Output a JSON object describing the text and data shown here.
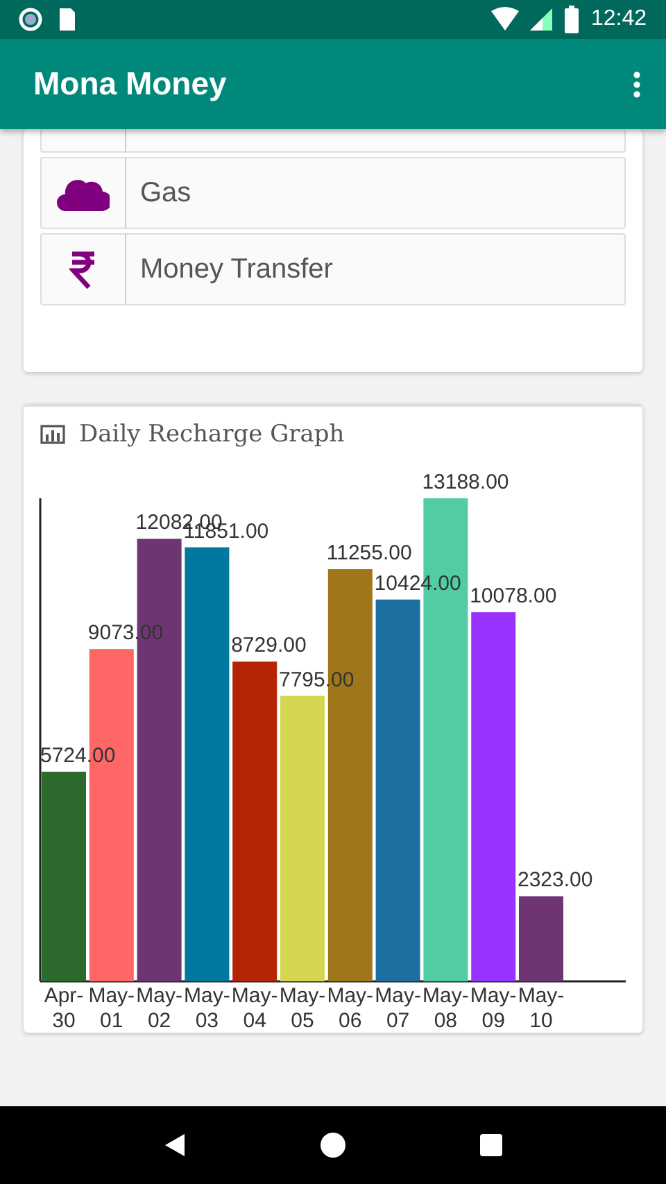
{
  "status_bar": {
    "time": "12:42"
  },
  "app_bar": {
    "title": "Mona Money"
  },
  "services": [
    {
      "kind": "partial"
    },
    {
      "kind": "cloud",
      "label": "Gas"
    },
    {
      "kind": "rupee",
      "label": "Money Transfer"
    }
  ],
  "graph_card": {
    "title": "Daily Recharge Graph",
    "chart_data": {
      "type": "bar",
      "categories": [
        "Apr-30",
        "May-01",
        "May-02",
        "May-03",
        "May-04",
        "May-05",
        "May-06",
        "May-07",
        "May-08",
        "May-09",
        "May-10"
      ],
      "values": [
        5724,
        9073,
        12082,
        11851,
        8729,
        7795,
        11255,
        10424,
        13188,
        10078,
        2323
      ],
      "colors": [
        "#2d6a2d",
        "#ff6666",
        "#6f3573",
        "#00789f",
        "#b32505",
        "#d4d652",
        "#a0761a",
        "#1c6fa0",
        "#52cca4",
        "#9933ff",
        "#6f3573"
      ],
      "value_labels": [
        "5724.00",
        "9073.00",
        "12082.00",
        "11851.00",
        "8729.00",
        "7795.00",
        "11255.00",
        "10424.00",
        "13188.00",
        "10078.00",
        "2323.00"
      ]
    }
  }
}
